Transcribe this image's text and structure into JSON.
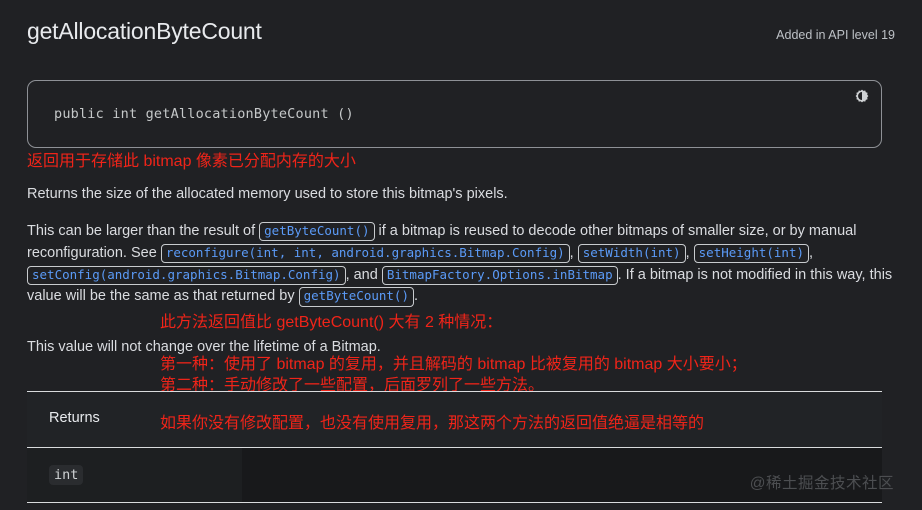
{
  "header": {
    "title": "getAllocationByteCount",
    "api_level": "Added in API level 19"
  },
  "code_block": {
    "signature": "public int getAllocationByteCount ()",
    "theme_toggle_icon": "brightness-contrast-icon"
  },
  "content": {
    "zh_summary": "返回用于存储此 bitmap 像素已分配内存的大小",
    "en_summary": "Returns the size of the allocated memory used to store this bitmap's pixels.",
    "para1": {
      "t1": "This can be larger than the result of ",
      "link1": "getByteCount()",
      "t2": " if a bitmap is reused to decode other bitmaps of smaller size, or by manual reconfiguration. See ",
      "link2": "reconfigure(int, int, android.graphics.Bitmap.Config)",
      "sep1": ", ",
      "link3": "setWidth(int)",
      "sep2": ", ",
      "link4": "setHeight(int)",
      "sep3": ", ",
      "link5": "setConfig(android.graphics.Bitmap.Config)",
      "sep4": ", and ",
      "link6": "BitmapFactory.Options.inBitmap",
      "t3": ". If a bitmap is not modified in this way, this value will be the same as that returned by ",
      "link7": "getByteCount()",
      "t4": "."
    },
    "para2": "This value will not change over the lifetime of a Bitmap."
  },
  "annotations": {
    "note1": "此方法返回值比 getByteCount() 大有 2 种情况：",
    "note2": "第一种：使用了 bitmap 的复用，并且解码的 bitmap 比被复用的 bitmap 大小要小；",
    "note3": "第二种：手动修改了一些配置，后面罗列了一些方法。",
    "note4": "如果你没有修改配置，也没有使用复用，那这两个方法的返回值绝逼是相等的"
  },
  "returns_table": {
    "label": "Returns",
    "type": "int"
  },
  "watermark": "@稀土掘金技术社区",
  "colors": {
    "background": "#202124",
    "text": "#e8eaed",
    "link": "#5b9bf8",
    "annotation_red": "#ef2419",
    "border": "#d9dbdd"
  }
}
